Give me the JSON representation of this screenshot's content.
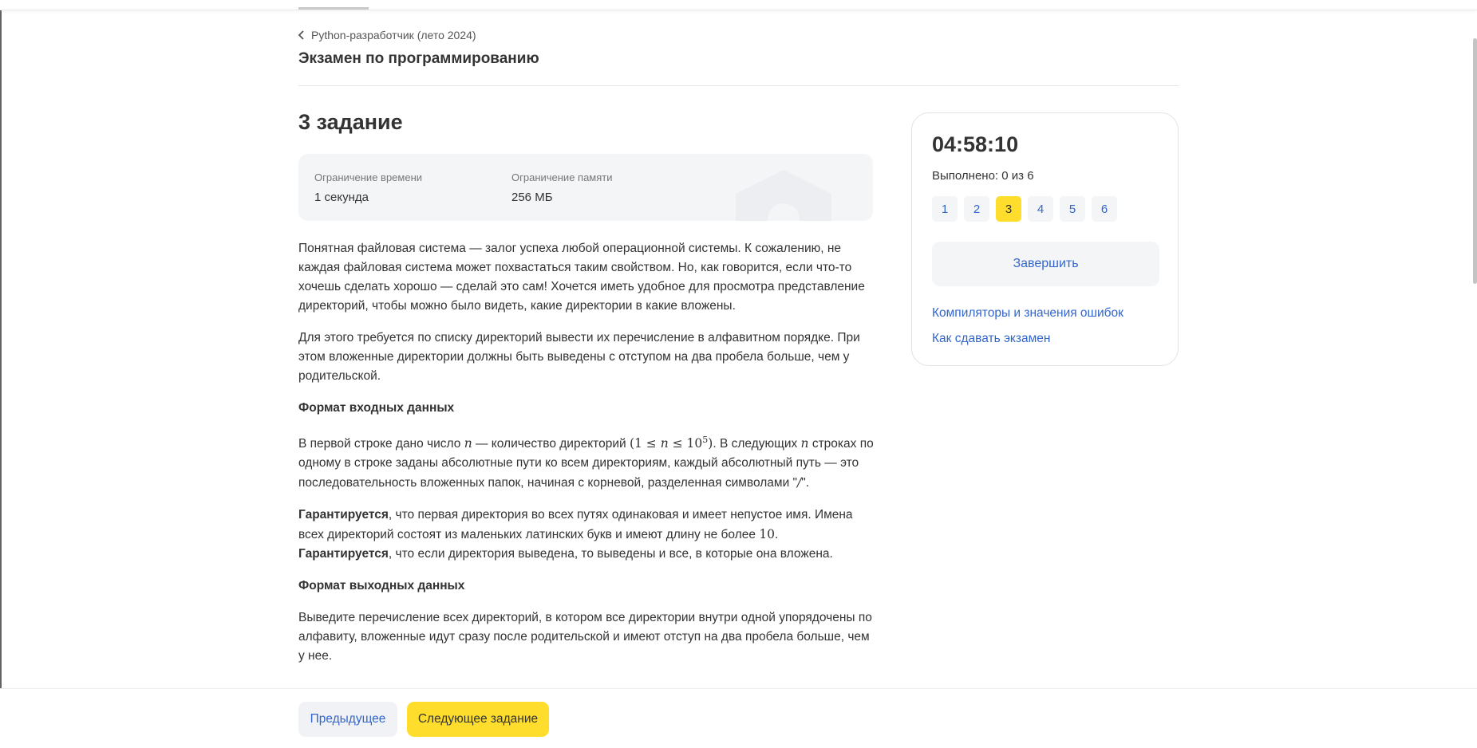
{
  "breadcrumb": {
    "label": "Python-разработчик (лето 2024)"
  },
  "page": {
    "title": "Экзамен по программированию"
  },
  "task": {
    "title": "3 задание",
    "limits": [
      {
        "label": "Ограничение времени",
        "value": "1 секунда"
      },
      {
        "label": "Ограничение памяти",
        "value": "256 МБ"
      }
    ]
  },
  "statement": {
    "p1": "Понятная файловая система — залог успеха любой операционной системы. К сожалению, не каждая файловая система может похвастаться таким свойством. Но, как говорится, если что-то хочешь сделать хорошо — сделай это сам! Хочется иметь удобное для просмотра представление директорий, чтобы можно было видеть, какие директории в какие вложены.",
    "p2": "Для этого требуется по списку директорий вывести их перечисление в алфавитном порядке. При этом вложенные директории должны быть выведены с отступом на два пробела больше, чем у родительской.",
    "input_heading": "Формат входных данных",
    "input": {
      "t1": "В первой строке дано число ",
      "var_n": "n",
      "t2": " — количество директорий ",
      "range_open": "(1 ≤ ",
      "range_mid": " ≤ 10",
      "range_exp": "5",
      "range_close": ")",
      "t3": ". В следующих ",
      "t4": " строках по одному в строке заданы абсолютные пути ко всем директориям, каждый абсолютный путь — это последовательность вложенных папок, начиная с корневой, разделенная символами \"",
      "slash": "/",
      "t5": "\"."
    },
    "guarantee": {
      "b1": "Гарантируется",
      "t1": ", что первая директория во всех путях одинаковая и имеет непустое имя. Имена всех директорий состоят из маленьких латинских букв и имеют длину не более ",
      "num": "10",
      "t2": ". ",
      "b2": "Гарантируется",
      "t3": ", что если директория выведена, то выведены и все, в которые она вложена."
    },
    "output_heading": "Формат выходных данных",
    "output": "Выведите перечисление всех директорий, в котором все директории внутри одной упорядочены по алфавиту, вложенные идут сразу после родительской и имеют отступ на два пробела больше, чем у нее."
  },
  "sidebar": {
    "timer": "04:58:10",
    "progress": "Выполнено: 0 из 6",
    "tasks": [
      "1",
      "2",
      "3",
      "4",
      "5",
      "6"
    ],
    "active_task": "3",
    "finish_label": "Завершить",
    "links": [
      "Компиляторы и значения ошибок",
      "Как сдавать экзамен"
    ]
  },
  "footer": {
    "prev_label": "Предыдущее",
    "next_label": "Следующее задание"
  },
  "colors": {
    "accent": "#ffdd2d",
    "link": "#3366cc",
    "panel": "#f4f5f7",
    "text": "#333333"
  }
}
